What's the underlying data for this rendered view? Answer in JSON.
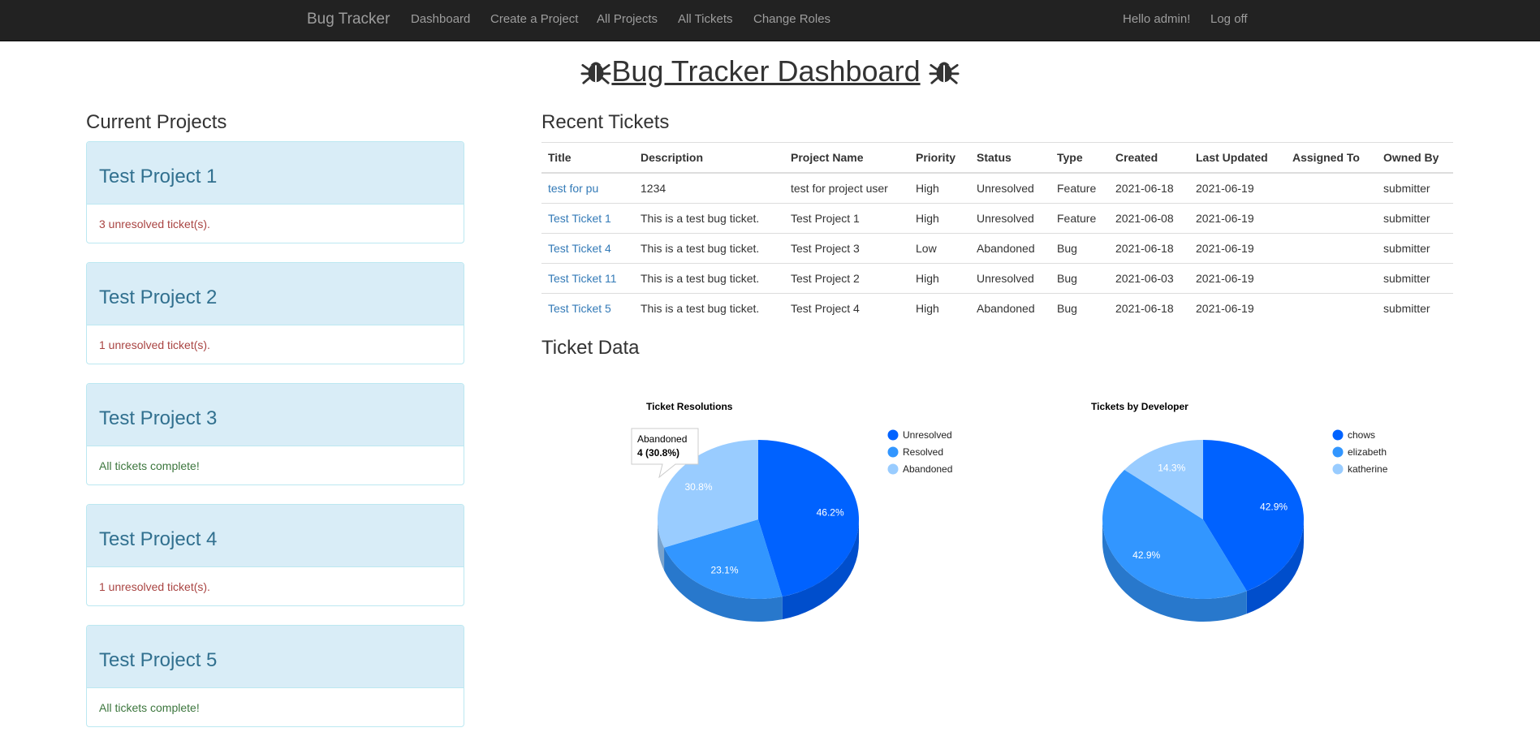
{
  "nav": {
    "brand": "Bug Tracker",
    "items": [
      "Dashboard",
      "Create a Project",
      "All Projects",
      "All Tickets",
      "Change Roles"
    ],
    "greeting": "Hello admin!",
    "logoff": "Log off"
  },
  "page_title": "Bug Tracker Dashboard",
  "projects_heading": "Current Projects",
  "projects": [
    {
      "name": "Test Project 1",
      "status": "3 unresolved ticket(s).",
      "state": "bad"
    },
    {
      "name": "Test Project 2",
      "status": "1 unresolved ticket(s).",
      "state": "bad"
    },
    {
      "name": "Test Project 3",
      "status": "All tickets complete!",
      "state": "good"
    },
    {
      "name": "Test Project 4",
      "status": "1 unresolved ticket(s).",
      "state": "bad"
    },
    {
      "name": "Test Project 5",
      "status": "All tickets complete!",
      "state": "good"
    }
  ],
  "tickets_heading": "Recent Tickets",
  "ticket_columns": [
    "Title",
    "Description",
    "Project Name",
    "Priority",
    "Status",
    "Type",
    "Created",
    "Last Updated",
    "Assigned To",
    "Owned By"
  ],
  "tickets": [
    {
      "title": "test for pu",
      "description": "1234",
      "project": "test for project user",
      "priority": "High",
      "status": "Unresolved",
      "type": "Feature",
      "created": "2021-06-18",
      "updated": "2021-06-19",
      "assigned": "",
      "owner": "submitter"
    },
    {
      "title": "Test Ticket 1",
      "description": "This is a test bug ticket.",
      "project": "Test Project 1",
      "priority": "High",
      "status": "Unresolved",
      "type": "Feature",
      "created": "2021-06-08",
      "updated": "2021-06-19",
      "assigned": "",
      "owner": "submitter"
    },
    {
      "title": "Test Ticket 4",
      "description": "This is a test bug ticket.",
      "project": "Test Project 3",
      "priority": "Low",
      "status": "Abandoned",
      "type": "Bug",
      "created": "2021-06-18",
      "updated": "2021-06-19",
      "assigned": "",
      "owner": "submitter"
    },
    {
      "title": "Test Ticket 11",
      "description": "This is a test bug ticket.",
      "project": "Test Project 2",
      "priority": "High",
      "status": "Unresolved",
      "type": "Bug",
      "created": "2021-06-03",
      "updated": "2021-06-19",
      "assigned": "",
      "owner": "submitter"
    },
    {
      "title": "Test Ticket 5",
      "description": "This is a test bug ticket.",
      "project": "Test Project 4",
      "priority": "High",
      "status": "Abandoned",
      "type": "Bug",
      "created": "2021-06-18",
      "updated": "2021-06-19",
      "assigned": "",
      "owner": "submitter"
    }
  ],
  "ticket_data_heading": "Ticket Data",
  "chart_data": [
    {
      "type": "pie",
      "title": "Ticket Resolutions",
      "categories": [
        "Unresolved",
        "Resolved",
        "Abandoned"
      ],
      "values": [
        6,
        3,
        4
      ],
      "percent_labels": [
        "46.2%",
        "23.1%",
        "30.8%"
      ],
      "colors": [
        "#0062ff",
        "#3296ff",
        "#99ccff"
      ],
      "legend": "right",
      "tooltip": {
        "label": "Abandoned",
        "value": "4 (30.8%)"
      }
    },
    {
      "type": "pie",
      "title": "Tickets by Developer",
      "categories": [
        "chows",
        "elizabeth",
        "katherine"
      ],
      "values": [
        3,
        3,
        1
      ],
      "percent_labels": [
        "42.9%",
        "42.9%",
        "14.3%"
      ],
      "colors": [
        "#0062ff",
        "#3296ff",
        "#99ccff"
      ],
      "legend": "right"
    }
  ]
}
